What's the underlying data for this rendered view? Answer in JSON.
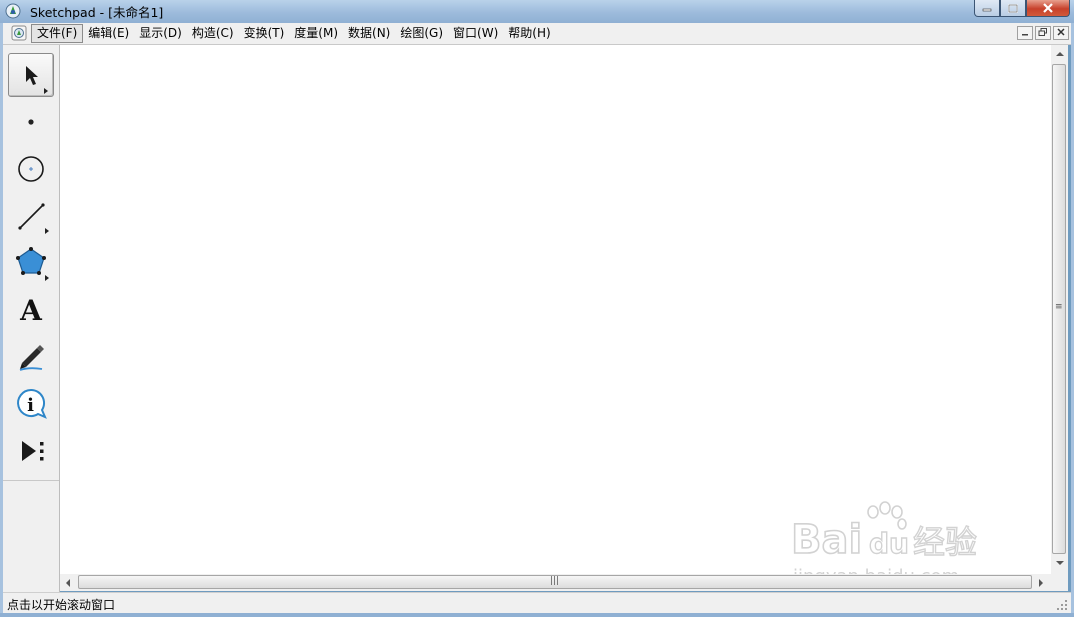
{
  "window": {
    "title": "Sketchpad  - [未命名1]",
    "accent_color": "#9dbbdc",
    "close_color": "#c7412b"
  },
  "menubar": {
    "items": [
      {
        "label": "文件(F)",
        "active": true
      },
      {
        "label": "编辑(E)"
      },
      {
        "label": "显示(D)"
      },
      {
        "label": "构造(C)"
      },
      {
        "label": "变换(T)"
      },
      {
        "label": "度量(M)"
      },
      {
        "label": "数据(N)"
      },
      {
        "label": "绘图(G)"
      },
      {
        "label": "窗口(W)"
      },
      {
        "label": "帮助(H)"
      }
    ]
  },
  "toolbox": {
    "tools": [
      {
        "name": "arrow-selection-tool",
        "icon": "arrow-cursor-icon",
        "selected": true
      },
      {
        "name": "point-tool",
        "icon": "point-icon"
      },
      {
        "name": "compass-tool",
        "icon": "circle-icon"
      },
      {
        "name": "straightedge-tool",
        "icon": "line-segment-icon"
      },
      {
        "name": "polygon-tool",
        "icon": "polygon-icon"
      },
      {
        "name": "text-tool",
        "icon": "text-a-icon",
        "glyph": "A"
      },
      {
        "name": "marker-tool",
        "icon": "marker-pen-icon"
      },
      {
        "name": "information-tool",
        "icon": "info-icon"
      },
      {
        "name": "custom-tools",
        "icon": "custom-tools-icon"
      }
    ]
  },
  "status": {
    "text": "点击以开始滚动窗口"
  },
  "watermark": {
    "brand": "Bai",
    "brand_suffix": "du",
    "cn": "经验",
    "url": "jingyan.baidu.com"
  }
}
